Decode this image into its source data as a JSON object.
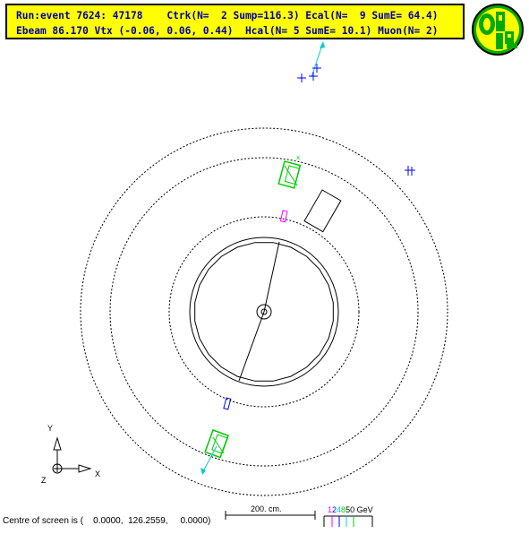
{
  "header": {
    "line1": "Run:event 7624: 47178    Ctrk(N=  2 Sump=116.3) Ecal(N=  9 SumE= 64.4)",
    "line2": "Ebeam 86.170 Vtx (-0.06, 0.06, 0.44)  Hcal(N= 5 SumE= 10.1) Muon(N= 2)"
  },
  "logo": {
    "name": "OPAL",
    "colors": {
      "fill": "#ffff00",
      "ink": "#00aa00"
    }
  },
  "status": {
    "centre_text": "Centre of screen is (    0.0000,  126.2559,     0.0000)"
  },
  "scale": {
    "label": "200. cm."
  },
  "energy_legend": {
    "items": [
      {
        "text": "1",
        "color": "#ff00ff"
      },
      {
        "text": "2",
        "color": "#0000ff"
      },
      {
        "text": "4",
        "color": "#00cccc"
      },
      {
        "text": "8",
        "color": "#00cc00"
      },
      {
        "text": "50 GeV",
        "color": "#000000"
      }
    ]
  },
  "axes": {
    "y": "Y",
    "x": "X",
    "z": "Z"
  },
  "colors": {
    "detector": "#000000",
    "track": "#000000",
    "ecal": "#00cc00",
    "hcal": "#ff00ff",
    "muon": "#0000ff",
    "jet": "#00cccc"
  }
}
